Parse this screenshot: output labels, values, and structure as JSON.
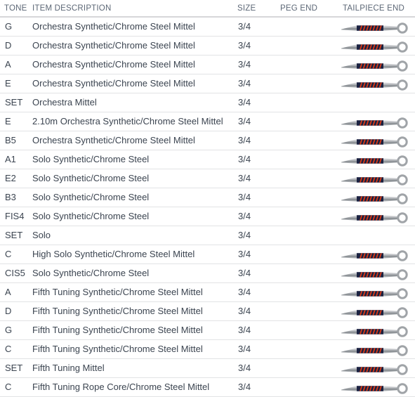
{
  "table": {
    "columns": [
      {
        "key": "tone",
        "label": "TONE"
      },
      {
        "key": "desc",
        "label": "ITEM DESCRIPTION"
      },
      {
        "key": "size",
        "label": "SIZE"
      },
      {
        "key": "peg",
        "label": "PEG END"
      },
      {
        "key": "tail",
        "label": "TAILPIECE END"
      }
    ],
    "colors": {
      "header_text": "#5c6776",
      "body_text": "#3b4450",
      "row_divider": "#e2e3e5",
      "header_divider": "#d6d7d9",
      "tail_shaft": "#9fa3a8",
      "tail_winding_dark": "#1b2140",
      "tail_winding_stripe": "#e03b16",
      "tail_ring": "#a0a4a8"
    },
    "rows": [
      {
        "tone": "G",
        "desc": "Orchestra Synthetic/Chrome Steel Mittel",
        "size": "3/4",
        "peg_colors": [
          "#6b3a1c"
        ],
        "has_peg": true,
        "has_tail": true
      },
      {
        "tone": "D",
        "desc": "Orchestra Synthetic/Chrome Steel Mittel",
        "size": "3/4",
        "peg_colors": [
          "#e03310"
        ],
        "has_peg": true,
        "has_tail": true
      },
      {
        "tone": "A",
        "desc": "Orchestra Synthetic/Chrome Steel Mittel",
        "size": "3/4",
        "peg_colors": [
          "#1b1c38"
        ],
        "has_peg": true,
        "has_tail": true
      },
      {
        "tone": "E",
        "desc": "Orchestra Synthetic/Chrome Steel Mittel",
        "size": "3/4",
        "peg_colors": [
          "#12907c"
        ],
        "has_peg": true,
        "has_tail": true
      },
      {
        "tone": "SET",
        "desc": "Orchestra Mittel",
        "size": "3/4",
        "peg_colors": [],
        "has_peg": false,
        "has_tail": false
      },
      {
        "tone": "E",
        "desc": "2.10m Orchestra Synthetic/Chrome Steel Mittel",
        "size": "3/4",
        "peg_colors": [
          "#12907c"
        ],
        "has_peg": true,
        "has_tail": true
      },
      {
        "tone": "B5",
        "desc": "Orchestra Synthetic/Chrome Steel Mittel",
        "size": "3/4",
        "peg_colors": [
          "#f2d000"
        ],
        "has_peg": true,
        "has_tail": true
      },
      {
        "tone": "A1",
        "desc": "Solo Synthetic/Chrome Steel",
        "size": "3/4",
        "peg_colors": [
          "#4e5f7a"
        ],
        "has_peg": true,
        "has_tail": true
      },
      {
        "tone": "E2",
        "desc": "Solo Synthetic/Chrome Steel",
        "size": "3/4",
        "peg_colors": [
          "#93c01b"
        ],
        "has_peg": true,
        "has_tail": true
      },
      {
        "tone": "B3",
        "desc": "Solo Synthetic/Chrome Steel",
        "size": "3/4",
        "peg_colors": [
          "#f2ce00"
        ],
        "has_peg": true,
        "has_tail": true
      },
      {
        "tone": "FIS4",
        "desc": "Solo Synthetic/Chrome Steel",
        "size": "3/4",
        "peg_colors": [
          "#3f93ec"
        ],
        "has_peg": true,
        "has_tail": true
      },
      {
        "tone": "SET",
        "desc": "Solo",
        "size": "3/4",
        "peg_colors": [],
        "has_peg": false,
        "has_tail": false
      },
      {
        "tone": "C",
        "desc": "High Solo Synthetic/Chrome Steel Mittel",
        "size": "3/4",
        "peg_colors": [
          "#3c1080"
        ],
        "has_peg": true,
        "has_tail": true
      },
      {
        "tone": "CIS5",
        "desc": "Solo Synthetic/Chrome Steel",
        "size": "3/4",
        "peg_colors": [
          "#8b87f5"
        ],
        "has_peg": true,
        "has_tail": true
      },
      {
        "tone": "A",
        "desc": "Fifth Tuning Synthetic/Chrome Steel Mittel",
        "size": "3/4",
        "peg_colors": [
          "#3a3a46",
          "#3f93ec"
        ],
        "has_peg": true,
        "has_tail": true
      },
      {
        "tone": "D",
        "desc": "Fifth Tuning Synthetic/Chrome Steel Mittel",
        "size": "3/4",
        "peg_colors": [
          "#13142a",
          "#3f93ec"
        ],
        "has_peg": true,
        "has_tail": true
      },
      {
        "tone": "G",
        "desc": "Fifth Tuning Synthetic/Chrome Steel Mittel",
        "size": "3/4",
        "peg_colors": [
          "#e03310",
          "#3f93ec"
        ],
        "has_peg": true,
        "has_tail": true
      },
      {
        "tone": "C",
        "desc": "Fifth Tuning Synthetic/Chrome Steel Mittel",
        "size": "3/4",
        "peg_colors": [
          "#7a3a14",
          "#3f93ec"
        ],
        "has_peg": true,
        "has_tail": true
      },
      {
        "tone": "SET",
        "desc": "Fifth Tuning Mittel",
        "size": "3/4",
        "peg_colors": [
          "#ab95f7",
          "#3f93ec"
        ],
        "has_peg": true,
        "has_tail": true
      },
      {
        "tone": "C",
        "desc": "Fifth Tuning Rope Core/Chrome Steel Mittel",
        "size": "3/4",
        "peg_colors": [
          "#5a18a8",
          "#3f93ec"
        ],
        "has_peg": true,
        "has_tail": true
      }
    ]
  }
}
